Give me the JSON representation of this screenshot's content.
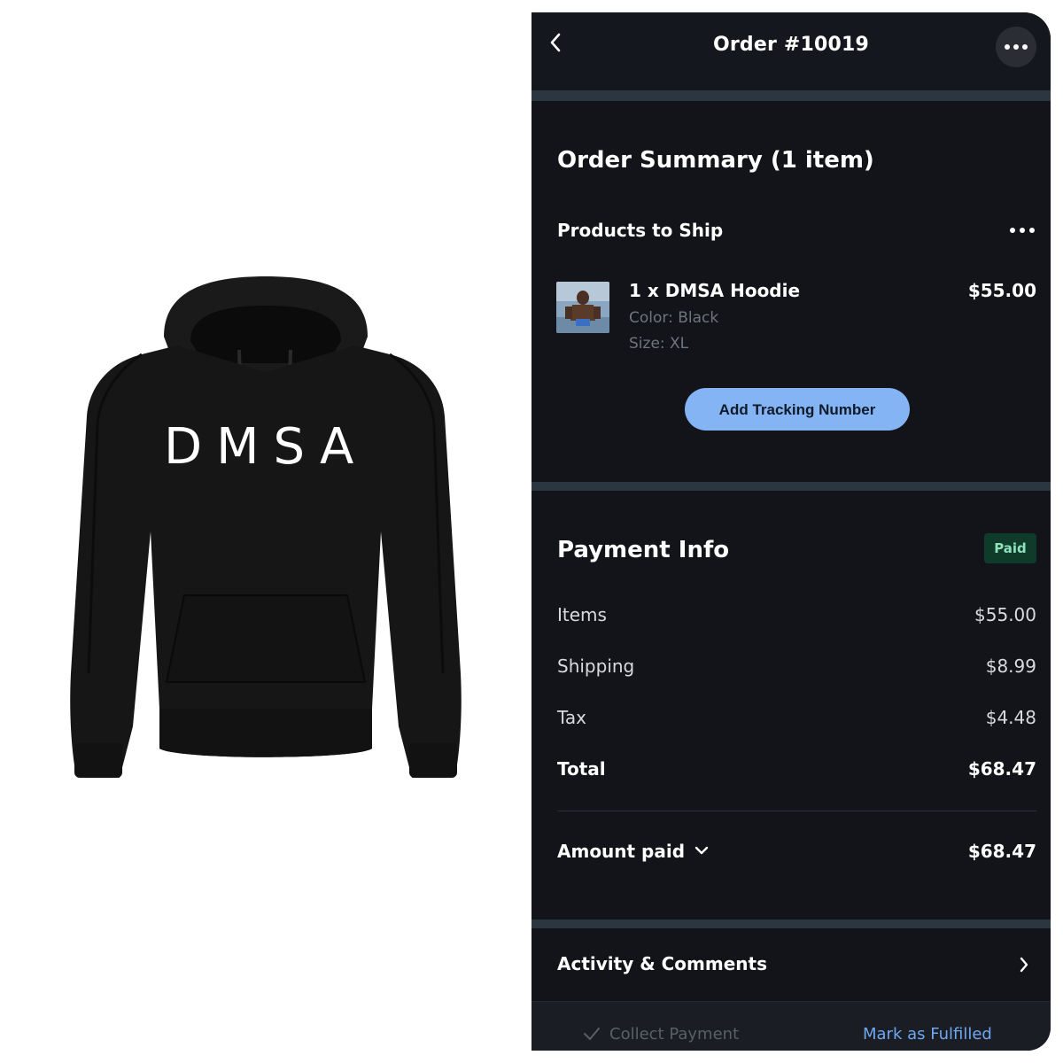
{
  "product_image": {
    "logo_text": "DMSA",
    "garment_color": "#141414"
  },
  "header": {
    "title": "Order #10019",
    "back_icon": "chevron-left-icon",
    "more_icon": "more-horizontal-icon"
  },
  "order_summary": {
    "title": "Order Summary (1 item)",
    "products_heading": "Products to Ship",
    "item": {
      "name": "1 x DMSA Hoodie",
      "color": "Color: Black",
      "size": "Size: XL",
      "price": "$55.00"
    },
    "tracking_button": "Add Tracking Number"
  },
  "payment": {
    "title": "Payment Info",
    "status_badge": "Paid",
    "rows": [
      {
        "label": "Items",
        "value": "$55.00"
      },
      {
        "label": "Shipping",
        "value": "$8.99"
      },
      {
        "label": "Tax",
        "value": "$4.48"
      },
      {
        "label": "Total",
        "value": "$68.47"
      }
    ],
    "amount_paid_label": "Amount paid",
    "amount_paid_value": "$68.47"
  },
  "activity": {
    "label": "Activity & Comments"
  },
  "bottom_bar": {
    "collect_payment": "Collect Payment",
    "mark_fulfilled": "Mark as Fulfilled"
  },
  "colors": {
    "background": "#121419",
    "accent_blue": "#84b4f3",
    "paid_badge_bg": "#0e3b2a",
    "paid_badge_text": "#8fe0bb",
    "link_blue": "#6fa8f2"
  }
}
